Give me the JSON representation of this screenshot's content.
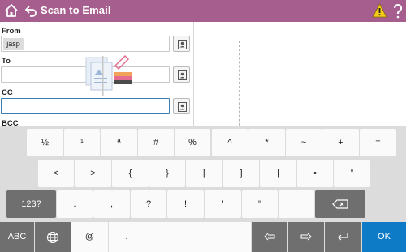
{
  "header": {
    "title": "Scan to Email",
    "home_icon": "home-icon",
    "back_icon": "back-arrow-icon",
    "warning_icon": "warning-triangle-icon",
    "help_icon": "help-icon",
    "bar_color": "#a65e8f"
  },
  "form": {
    "from_label": "From",
    "from_value": "jasp",
    "to_label": "To",
    "to_value": "",
    "cc_label": "CC",
    "cc_value": "",
    "bcc_label": "BCC",
    "address_book_icon": "address-book-icon"
  },
  "preview": {
    "placeholder_icon": "document-preview-icon"
  },
  "keyboard": {
    "row1": [
      "½",
      "¹",
      "ª",
      "#",
      "%",
      "^",
      "*",
      "~",
      "+",
      "="
    ],
    "row2": [
      "<",
      ">",
      "{",
      "}",
      "[",
      "]",
      "|",
      "•",
      "°"
    ],
    "row3_mode": "123?",
    "row3": [
      ".",
      ",",
      "?",
      "!",
      "'",
      "\""
    ],
    "row3_backspace_icon": "backspace-icon",
    "row4_abc": "ABC",
    "row4_globe_icon": "globe-icon",
    "row4_at": "@",
    "row4_dot": ".",
    "row4_left_icon": "arrow-left-icon",
    "row4_right_icon": "arrow-right-icon",
    "row4_enter_icon": "enter-icon",
    "row4_ok": "OK",
    "accent_color": "#0e7bc6"
  }
}
